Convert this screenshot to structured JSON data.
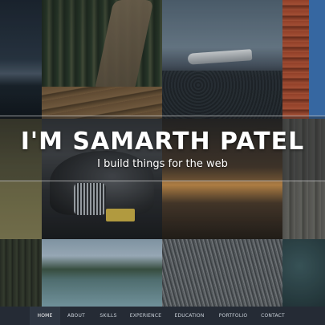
{
  "hero": {
    "title": "I'M SAMARTH PATEL",
    "subtitle": "I build things for the web"
  },
  "nav": {
    "active": "HOME",
    "items": [
      {
        "label": "HOME"
      },
      {
        "label": "ABOUT"
      },
      {
        "label": "SKILLS"
      },
      {
        "label": "EXPERIENCE"
      },
      {
        "label": "EDUCATION"
      },
      {
        "label": "PORTFOLIO"
      },
      {
        "label": "CONTACT"
      }
    ]
  },
  "colors": {
    "navbar_bg": "#252b35",
    "nav_active_bg": "#2f3743",
    "hero_text": "#ffffff"
  }
}
